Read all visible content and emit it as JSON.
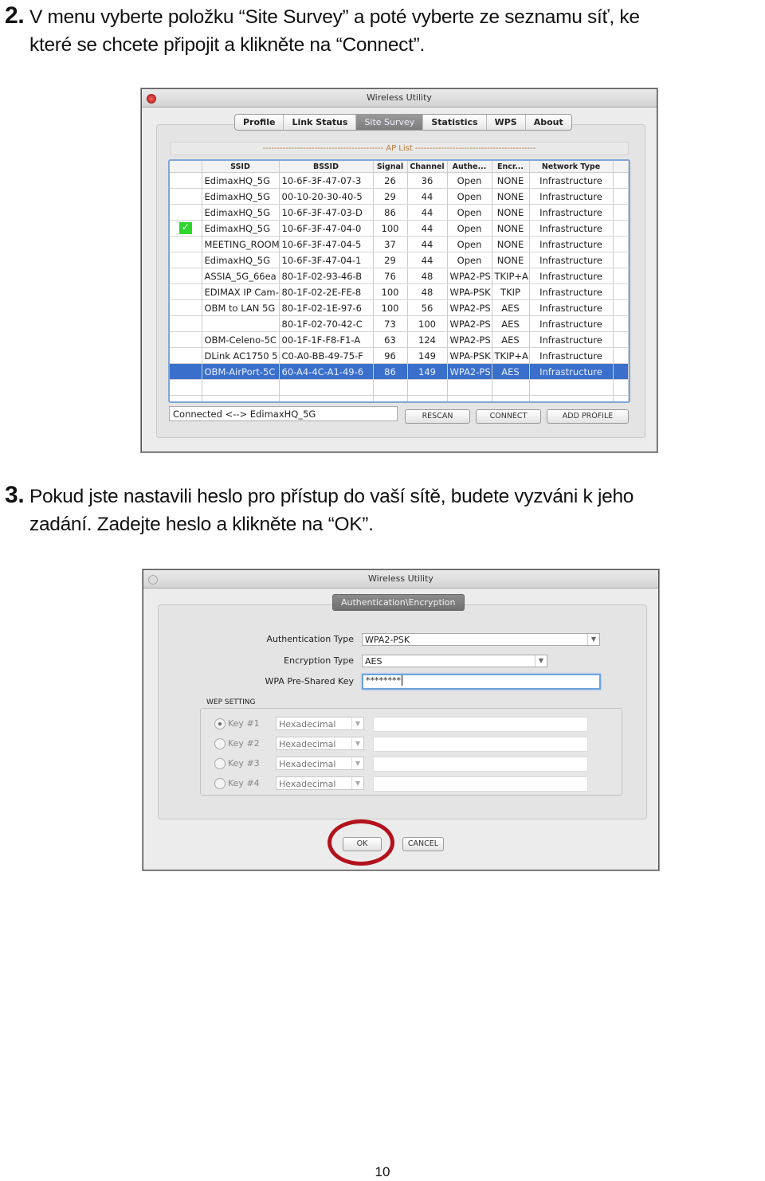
{
  "step2": {
    "number": "2.",
    "line1": "V menu vyberte položku “Site Survey” a poté vyberte ze seznamu síť, ke",
    "line2": "které se chcete připojit a klikněte na “Connect”."
  },
  "window1": {
    "title": "Wireless Utility",
    "tabs": [
      "Profile",
      "Link Status",
      "Site Survey",
      "Statistics",
      "WPS",
      "About"
    ],
    "active_tab": "Site Survey",
    "ap_list_label": "------------------------------------------ AP List ------------------------------------------",
    "columns": [
      "",
      "SSID",
      "BSSID",
      "Signal",
      "Channel",
      "Authe...",
      "Encr...",
      "Network Type"
    ],
    "rows": [
      {
        "icon": "",
        "ssid": "EdimaxHQ_5G",
        "bssid": "10-6F-3F-47-07-3",
        "signal": "26",
        "channel": "36",
        "auth": "Open",
        "encr": "NONE",
        "type": "Infrastructure"
      },
      {
        "icon": "",
        "ssid": "EdimaxHQ_5G",
        "bssid": "00-10-20-30-40-5",
        "signal": "29",
        "channel": "44",
        "auth": "Open",
        "encr": "NONE",
        "type": "Infrastructure"
      },
      {
        "icon": "",
        "ssid": "EdimaxHQ_5G",
        "bssid": "10-6F-3F-47-03-D",
        "signal": "86",
        "channel": "44",
        "auth": "Open",
        "encr": "NONE",
        "type": "Infrastructure"
      },
      {
        "icon": "connected-icon",
        "ssid": "EdimaxHQ_5G",
        "bssid": "10-6F-3F-47-04-0",
        "signal": "100",
        "channel": "44",
        "auth": "Open",
        "encr": "NONE",
        "type": "Infrastructure"
      },
      {
        "icon": "",
        "ssid": "MEETING_ROOM",
        "bssid": "10-6F-3F-47-04-5",
        "signal": "37",
        "channel": "44",
        "auth": "Open",
        "encr": "NONE",
        "type": "Infrastructure"
      },
      {
        "icon": "",
        "ssid": "EdimaxHQ_5G",
        "bssid": "10-6F-3F-47-04-1",
        "signal": "29",
        "channel": "44",
        "auth": "Open",
        "encr": "NONE",
        "type": "Infrastructure"
      },
      {
        "icon": "",
        "ssid": "ASSIA_5G_66ea",
        "bssid": "80-1F-02-93-46-B",
        "signal": "76",
        "channel": "48",
        "auth": "WPA2-PS",
        "encr": "TKIP+A",
        "type": "Infrastructure"
      },
      {
        "icon": "",
        "ssid": "EDIMAX IP Cam-",
        "bssid": "80-1F-02-2E-FE-8",
        "signal": "100",
        "channel": "48",
        "auth": "WPA-PSK",
        "encr": "TKIP",
        "type": "Infrastructure"
      },
      {
        "icon": "",
        "ssid": "OBM to LAN 5G",
        "bssid": "80-1F-02-1E-97-6",
        "signal": "100",
        "channel": "56",
        "auth": "WPA2-PS",
        "encr": "AES",
        "type": "Infrastructure"
      },
      {
        "icon": "",
        "ssid": "",
        "bssid": "80-1F-02-70-42-C",
        "signal": "73",
        "channel": "100",
        "auth": "WPA2-PS",
        "encr": "AES",
        "type": "Infrastructure"
      },
      {
        "icon": "",
        "ssid": "OBM-Celeno-5C",
        "bssid": "00-1F-1F-F8-F1-A",
        "signal": "63",
        "channel": "124",
        "auth": "WPA2-PS",
        "encr": "AES",
        "type": "Infrastructure"
      },
      {
        "icon": "",
        "ssid": "DLink AC1750 5",
        "bssid": "C0-A0-BB-49-75-F",
        "signal": "96",
        "channel": "149",
        "auth": "WPA-PSK",
        "encr": "TKIP+A",
        "type": "Infrastructure"
      },
      {
        "icon": "",
        "ssid": "OBM-AirPort-5C",
        "bssid": "60-A4-4C-A1-49-6",
        "signal": "86",
        "channel": "149",
        "auth": "WPA2-PS",
        "encr": "AES",
        "type": "Infrastructure",
        "selected": true
      }
    ],
    "status_text": "Connected <--> EdimaxHQ_5G",
    "buttons": {
      "rescan": "RESCAN",
      "connect": "CONNECT",
      "add_profile": "ADD PROFILE"
    }
  },
  "step3": {
    "number": "3.",
    "line1": "Pokud jste nastavili heslo pro přístup do vaší sítě, budete vyzváni k jeho",
    "line2": "zadání. Zadejte heslo a klikněte na “OK”."
  },
  "window2": {
    "title": "Wireless Utility",
    "dialog_title": "Authentication\\Encryption",
    "auth_type_label": "Authentication Type",
    "auth_type_value": "WPA2-PSK",
    "enc_type_label": "Encryption Type",
    "enc_type_value": "AES",
    "psk_label": "WPA Pre-Shared Key",
    "psk_value": "********",
    "wep_label": "WEP SETTING",
    "wep_keys": [
      {
        "label": "Key #1",
        "format": "Hexadecimal",
        "selected": true,
        "value": ""
      },
      {
        "label": "Key #2",
        "format": "Hexadecimal",
        "selected": false,
        "value": ""
      },
      {
        "label": "Key #3",
        "format": "Hexadecimal",
        "selected": false,
        "value": ""
      },
      {
        "label": "Key #4",
        "format": "Hexadecimal",
        "selected": false,
        "value": ""
      }
    ],
    "ok_label": "OK",
    "cancel_label": "CANCEL",
    "highlight_color": "#b3121c"
  },
  "page_number": "10"
}
